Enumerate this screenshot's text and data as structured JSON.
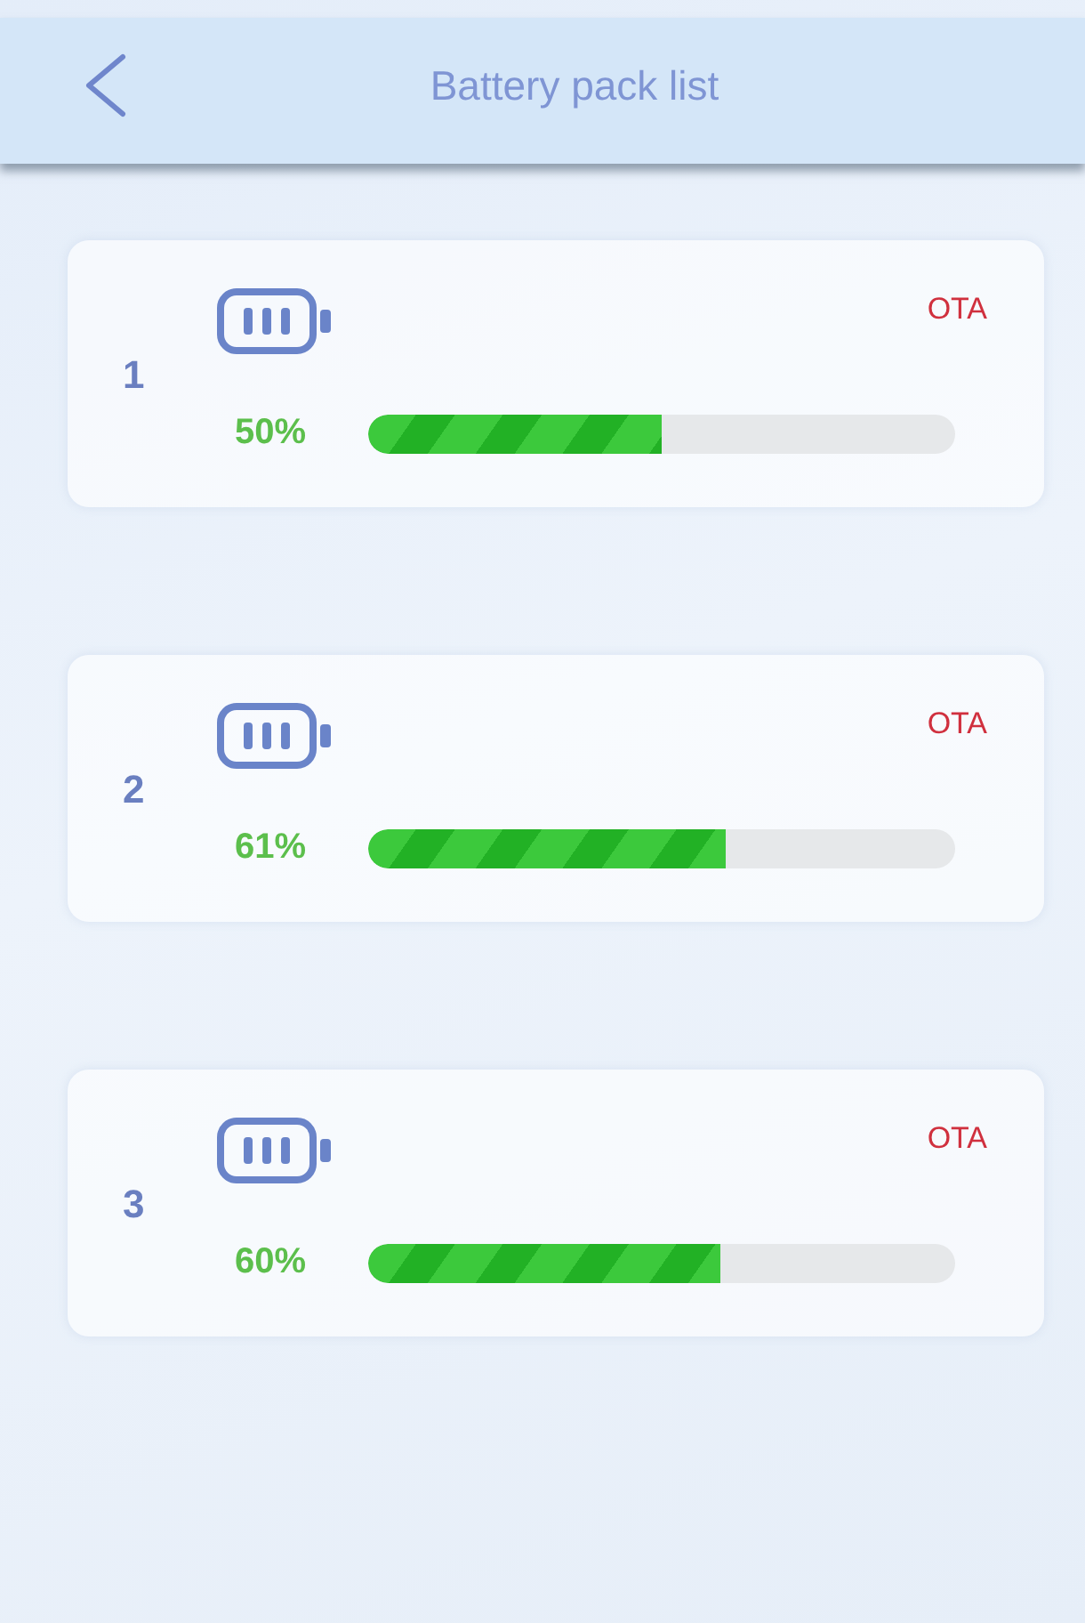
{
  "header": {
    "title": "Battery pack list"
  },
  "packs": [
    {
      "number": "1",
      "status": "OTA",
      "reading": "50%",
      "level": 0.5
    },
    {
      "number": "2",
      "status": "OTA",
      "reading": "61%",
      "level": 0.61
    },
    {
      "number": "3",
      "status": "OTA",
      "reading": "60%",
      "level": 0.6
    }
  ]
}
